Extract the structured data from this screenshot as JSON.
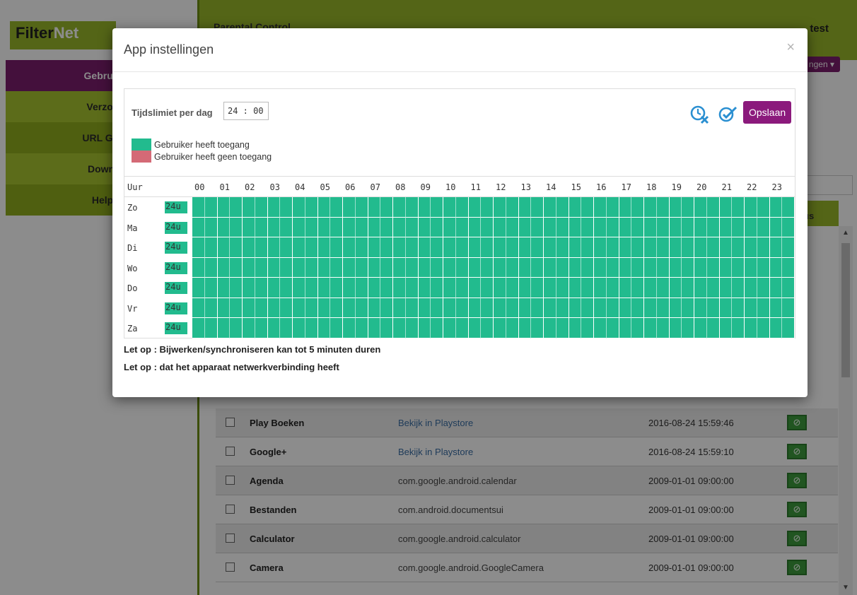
{
  "brand": {
    "logo_text_a": "Filter",
    "logo_text_b": "Net"
  },
  "header": {
    "title": "Parental Control",
    "user": "test",
    "settings_btn": "ngen"
  },
  "sidebar": {
    "items": [
      {
        "label": "Gebruik"
      },
      {
        "label": "Verzoe"
      },
      {
        "label": "URL Gro"
      },
      {
        "label": "Downl"
      },
      {
        "label": "Help"
      }
    ]
  },
  "table": {
    "status_header": "us",
    "rows": [
      {
        "name": "Play Boeken",
        "pkg": "Bekijk in Playstore",
        "link": true,
        "date": "2016-08-24 15:59:46",
        "status": "ok"
      },
      {
        "name": "Google+",
        "pkg": "Bekijk in Playstore",
        "link": true,
        "date": "2016-08-24 15:59:10",
        "status": "ok"
      },
      {
        "name": "Agenda",
        "pkg": "com.google.android.calendar",
        "link": false,
        "date": "2009-01-01 09:00:00",
        "status": "ok"
      },
      {
        "name": "Bestanden",
        "pkg": "com.android.documentsui",
        "link": false,
        "date": "2009-01-01 09:00:00",
        "status": "ok"
      },
      {
        "name": "Calculator",
        "pkg": "com.google.android.calculator",
        "link": false,
        "date": "2009-01-01 09:00:00",
        "status": "ok"
      },
      {
        "name": "Camera",
        "pkg": "com.google.android.GoogleCamera",
        "link": false,
        "date": "2009-01-01 09:00:00",
        "status": "ok"
      }
    ]
  },
  "modal": {
    "title": "App instellingen",
    "close": "×",
    "limit_label": "Tijdslimiet per dag",
    "limit_value": "24 : 00",
    "save_label": "Opslaan",
    "legend": [
      {
        "label": "Gebruiker heeft toegang",
        "color": "#22bb8e"
      },
      {
        "label": "Gebruiker heeft geen toegang",
        "color": "#d46a76"
      }
    ],
    "grid": {
      "uur_label": "Uur",
      "hours": [
        "00",
        "01",
        "02",
        "03",
        "04",
        "05",
        "06",
        "07",
        "08",
        "09",
        "10",
        "11",
        "12",
        "13",
        "14",
        "15",
        "16",
        "17",
        "18",
        "19",
        "20",
        "21",
        "22",
        "23"
      ],
      "days": [
        {
          "label": "Zo",
          "total": "24u"
        },
        {
          "label": "Ma",
          "total": "24u"
        },
        {
          "label": "Di",
          "total": "24u"
        },
        {
          "label": "Wo",
          "total": "24u"
        },
        {
          "label": "Do",
          "total": "24u"
        },
        {
          "label": "Vr",
          "total": "24u"
        },
        {
          "label": "Za",
          "total": "24u"
        }
      ],
      "access_color": "#22bb8e"
    },
    "notes": [
      "Let op : Bijwerken/synchroniseren kan tot 5 minuten duren",
      "Let op : dat het apparaat netwerkverbinding heeft"
    ]
  },
  "colors": {
    "brand_green": "#9ab82a",
    "brand_purple": "#7c1e6e",
    "icon_blue": "#2a8fd1"
  }
}
